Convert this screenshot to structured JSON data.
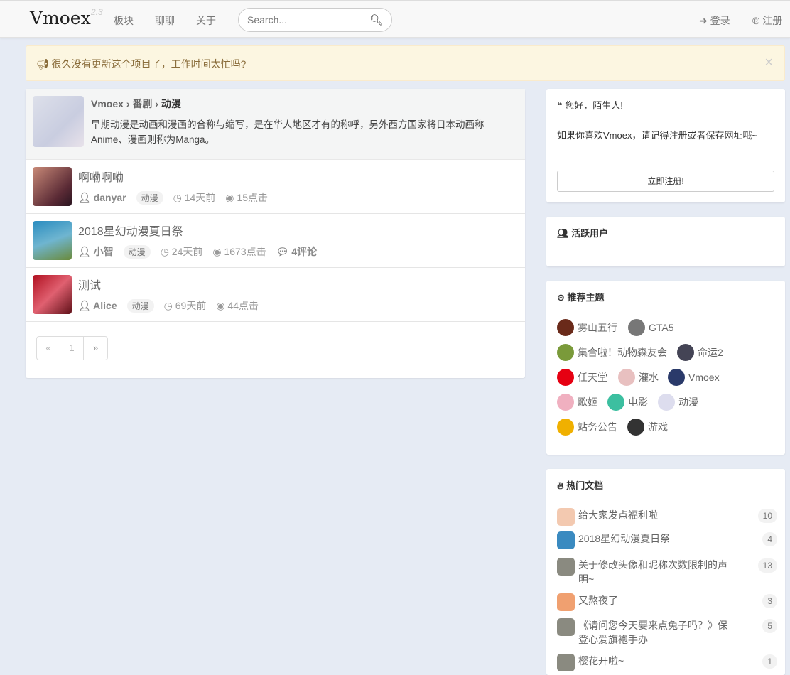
{
  "nav": {
    "brand": "Vmoex",
    "version": "2.3",
    "links": [
      "板块",
      "聊聊",
      "关于"
    ],
    "search_placeholder": "Search...",
    "login": "登录",
    "register": "注册"
  },
  "alert": {
    "text": "很久没有更新这个项目了，工作时间太忙吗?",
    "close": "×"
  },
  "node": {
    "crumb": [
      "Vmoex",
      "番剧",
      "动漫"
    ],
    "sep": "›",
    "desc": "早期动漫是动画和漫画的合称与缩写，是在华人地区才有的称呼，另外西方国家将日本动画称Anime、漫画则称为Manga。"
  },
  "posts": [
    {
      "title": "啊嘞啊嘞",
      "user": "danyar",
      "tag": "动漫",
      "time": "14天前",
      "views": "15点击",
      "comments": ""
    },
    {
      "title": "2018星幻动漫夏日祭",
      "user": "小智",
      "tag": "动漫",
      "time": "24天前",
      "views": "1673点击",
      "comments": "4评论"
    },
    {
      "title": "测试",
      "user": "Alice",
      "tag": "动漫",
      "time": "69天前",
      "views": "44点击",
      "comments": ""
    }
  ],
  "pager": {
    "prev": "«",
    "page": "1",
    "next": "»"
  },
  "welcome": {
    "title": "您好，陌生人!",
    "text": "如果你喜欢Vmoex，请记得注册或者保存网址哦~",
    "button": "立即注册!"
  },
  "active": {
    "title": "活跃用户"
  },
  "topics": {
    "title": "推荐主题",
    "items": [
      "雾山五行",
      "GTA5",
      "集合啦！动物森友会",
      "命运2",
      "任天堂",
      "灌水",
      "Vmoex",
      "歌姬",
      "电影",
      "动漫",
      "站务公告",
      "游戏"
    ]
  },
  "hot": {
    "title": "热门文档",
    "items": [
      {
        "title": "给大家发点福利啦",
        "count": "10"
      },
      {
        "title": "2018星幻动漫夏日祭",
        "count": "4"
      },
      {
        "title": "关于修改头像和昵称次数限制的声明~",
        "count": "13"
      },
      {
        "title": "又熬夜了",
        "count": "3"
      },
      {
        "title": "《请问您今天要来点兔子吗？》保登心爱旗袍手办",
        "count": "5"
      },
      {
        "title": "樱花开啦~",
        "count": "1"
      }
    ]
  }
}
